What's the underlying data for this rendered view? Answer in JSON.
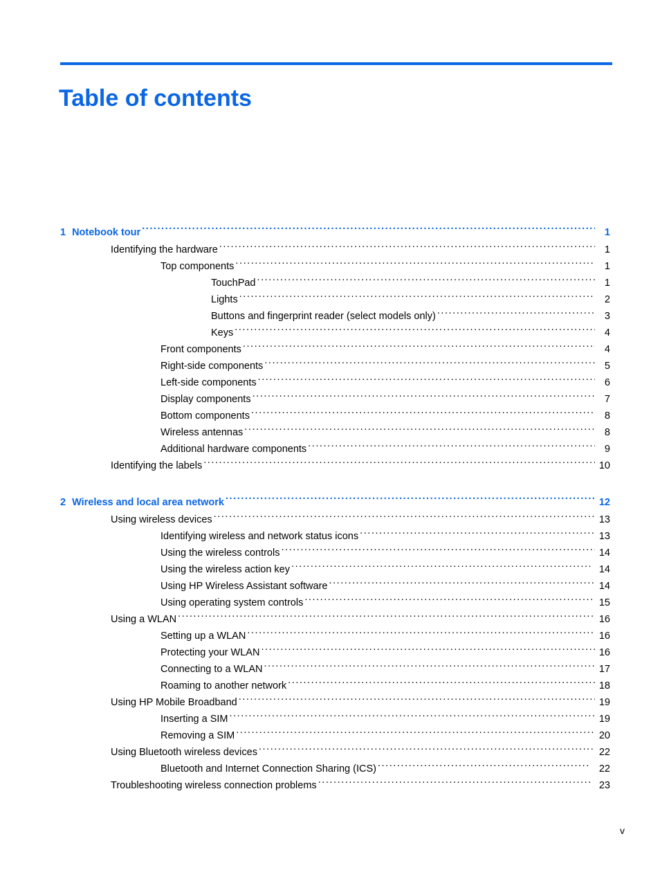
{
  "document": {
    "title": "Table of contents",
    "folio": "v",
    "accent_color": "#0b66e4",
    "text_color": "#000000"
  },
  "toc": {
    "entries": [
      {
        "kind": "chapter",
        "number": "1",
        "label": "Notebook tour",
        "page": "1",
        "level": 0,
        "wide": false
      },
      {
        "kind": "entry",
        "number": "",
        "label": "Identifying the hardware",
        "page": "1",
        "level": 1,
        "wide": false
      },
      {
        "kind": "entry",
        "number": "",
        "label": "Top components",
        "page": "1",
        "level": 2,
        "wide": false
      },
      {
        "kind": "entry",
        "number": "",
        "label": "TouchPad",
        "page": "1",
        "level": 3,
        "wide": false
      },
      {
        "kind": "entry",
        "number": "",
        "label": "Lights",
        "page": "2",
        "level": 3,
        "wide": false
      },
      {
        "kind": "entry",
        "number": "",
        "label": "Buttons and fingerprint reader (select models only)",
        "page": "3",
        "level": 3,
        "wide": false
      },
      {
        "kind": "entry",
        "number": "",
        "label": "Keys",
        "page": "4",
        "level": 3,
        "wide": false
      },
      {
        "kind": "entry",
        "number": "",
        "label": "Front components",
        "page": "4",
        "level": 2,
        "wide": false
      },
      {
        "kind": "entry",
        "number": "",
        "label": "Right-side components",
        "page": "5",
        "level": 2,
        "wide": false
      },
      {
        "kind": "entry",
        "number": "",
        "label": "Left-side components",
        "page": "6",
        "level": 2,
        "wide": false
      },
      {
        "kind": "entry",
        "number": "",
        "label": "Display components",
        "page": "7",
        "level": 2,
        "wide": false
      },
      {
        "kind": "entry",
        "number": "",
        "label": "Bottom components",
        "page": "8",
        "level": 2,
        "wide": false
      },
      {
        "kind": "entry",
        "number": "",
        "label": "Wireless antennas",
        "page": "8",
        "level": 2,
        "wide": false
      },
      {
        "kind": "entry",
        "number": "",
        "label": "Additional hardware components",
        "page": "9",
        "level": 2,
        "wide": false
      },
      {
        "kind": "entry",
        "number": "",
        "label": "Identifying the labels",
        "page": "10",
        "level": 1,
        "wide": false
      },
      {
        "kind": "chapter",
        "number": "2",
        "label": "Wireless and local area network",
        "page": "12",
        "level": 0,
        "wide": false
      },
      {
        "kind": "entry",
        "number": "",
        "label": "Using wireless devices",
        "page": "13",
        "level": 1,
        "wide": false
      },
      {
        "kind": "entry",
        "number": "",
        "label": "Identifying wireless and network status icons",
        "page": "13",
        "level": 2,
        "wide": false
      },
      {
        "kind": "entry",
        "number": "",
        "label": "Using the wireless controls",
        "page": "14",
        "level": 2,
        "wide": false
      },
      {
        "kind": "entry",
        "number": "",
        "label": "Using the wireless action key",
        "page": "14",
        "level": 2,
        "wide": true
      },
      {
        "kind": "entry",
        "number": "",
        "label": "Using HP Wireless Assistant software",
        "page": "14",
        "level": 2,
        "wide": false
      },
      {
        "kind": "entry",
        "number": "",
        "label": "Using operating system controls",
        "page": "15",
        "level": 2,
        "wide": false
      },
      {
        "kind": "entry",
        "number": "",
        "label": "Using a WLAN",
        "page": "16",
        "level": 1,
        "wide": false
      },
      {
        "kind": "entry",
        "number": "",
        "label": "Setting up a WLAN",
        "page": "16",
        "level": 2,
        "wide": false
      },
      {
        "kind": "entry",
        "number": "",
        "label": "Protecting your WLAN",
        "page": "16",
        "level": 2,
        "wide": false
      },
      {
        "kind": "entry",
        "number": "",
        "label": "Connecting to a WLAN",
        "page": "17",
        "level": 2,
        "wide": false
      },
      {
        "kind": "entry",
        "number": "",
        "label": "Roaming to another network",
        "page": "18",
        "level": 2,
        "wide": false
      },
      {
        "kind": "entry",
        "number": "",
        "label": "Using HP Mobile Broadband",
        "page": "19",
        "level": 1,
        "wide": false
      },
      {
        "kind": "entry",
        "number": "",
        "label": "Inserting a SIM",
        "page": "19",
        "level": 2,
        "wide": false
      },
      {
        "kind": "entry",
        "number": "",
        "label": "Removing a SIM",
        "page": "20",
        "level": 2,
        "wide": false
      },
      {
        "kind": "entry",
        "number": "",
        "label": "Using Bluetooth wireless devices",
        "page": "22",
        "level": 1,
        "wide": false
      },
      {
        "kind": "entry",
        "number": "",
        "label": "Bluetooth and Internet Connection Sharing (ICS)",
        "page": "22",
        "level": 2,
        "wide": true
      },
      {
        "kind": "entry",
        "number": "",
        "label": "Troubleshooting wireless connection problems",
        "page": "23",
        "level": 1,
        "wide": true
      }
    ]
  }
}
